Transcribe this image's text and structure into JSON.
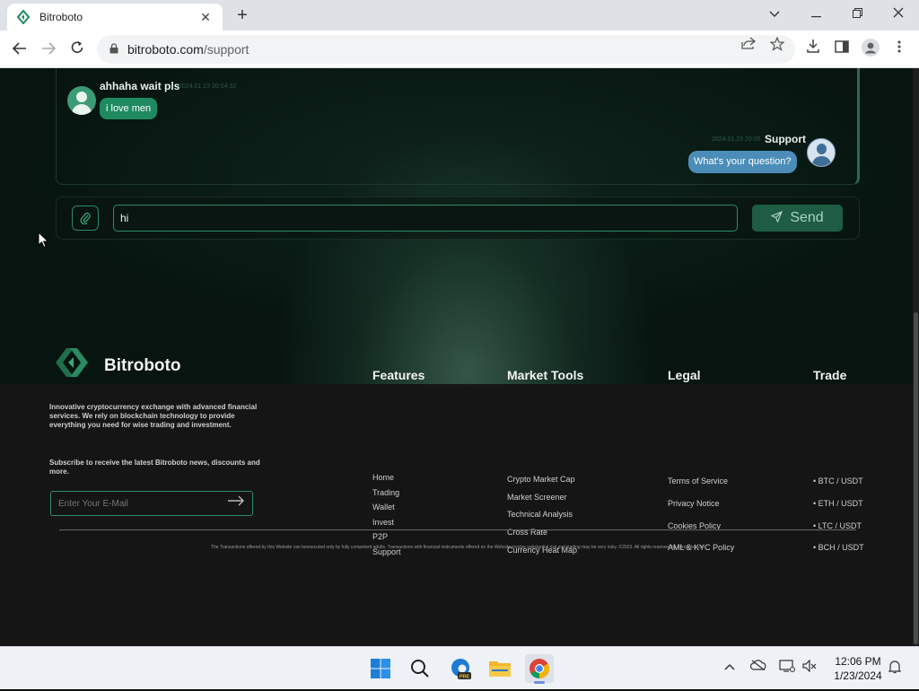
{
  "browser": {
    "tab_title": "Bitroboto",
    "tab_close": "✕",
    "new_tab": "+",
    "url_host": "bitroboto.com",
    "url_path": "/support"
  },
  "chat": {
    "messages": [
      {
        "sender": "ahhaha wait pls",
        "time": "2024.01.23 20:04:32",
        "text": "i love men"
      },
      {
        "sender": "Support",
        "time": "2024.01.23 20:05",
        "text": "What's your question?"
      }
    ],
    "input_value": "hi",
    "send_label": "Send"
  },
  "footer": {
    "brand": "Bitroboto",
    "about": "Innovative cryptocurrency exchange with advanced financial services. We rely on blockchain technology to provide everything you need for wise trading and investment.",
    "subscribe_text": "Subscribe to receive the latest Bitroboto news, discounts and more.",
    "email_placeholder": "Enter Your E-Mail",
    "columns": {
      "features": {
        "title": "Features",
        "links": [
          "Home",
          "Trading",
          "Wallet",
          "Invest",
          "P2P",
          "Support"
        ]
      },
      "market_tools": {
        "title": "Market Tools",
        "links": [
          "Crypto Market Cap",
          "Market Screener",
          "Technical Analysis",
          "Cross Rate",
          "Currency Heat Map"
        ]
      },
      "legal": {
        "title": "Legal",
        "links": [
          "Terms of Service",
          "Privacy Notice",
          "Cookies Policy",
          "AML & KYC Policy"
        ]
      },
      "trade": {
        "title": "Trade",
        "links": [
          "• BTC / USDT",
          "• ETH / USDT",
          "• LTC / USDT",
          "• BCH / USDT"
        ]
      }
    },
    "copyright": "The Transactions offered by this Website can beexecuted only by fully competent adults. Transactions with financial instruments offered on the Website involve substantial risk and trading may be very risky. ©2023. All rights reserved by bitroboto.com"
  },
  "taskbar": {
    "time": "12:06 PM",
    "date": "1/23/2024",
    "edge_badge": "PRE"
  },
  "colors": {
    "accent": "#1f8a60",
    "support_bubble": "#4b8db8",
    "footer_bg": "#151515"
  }
}
